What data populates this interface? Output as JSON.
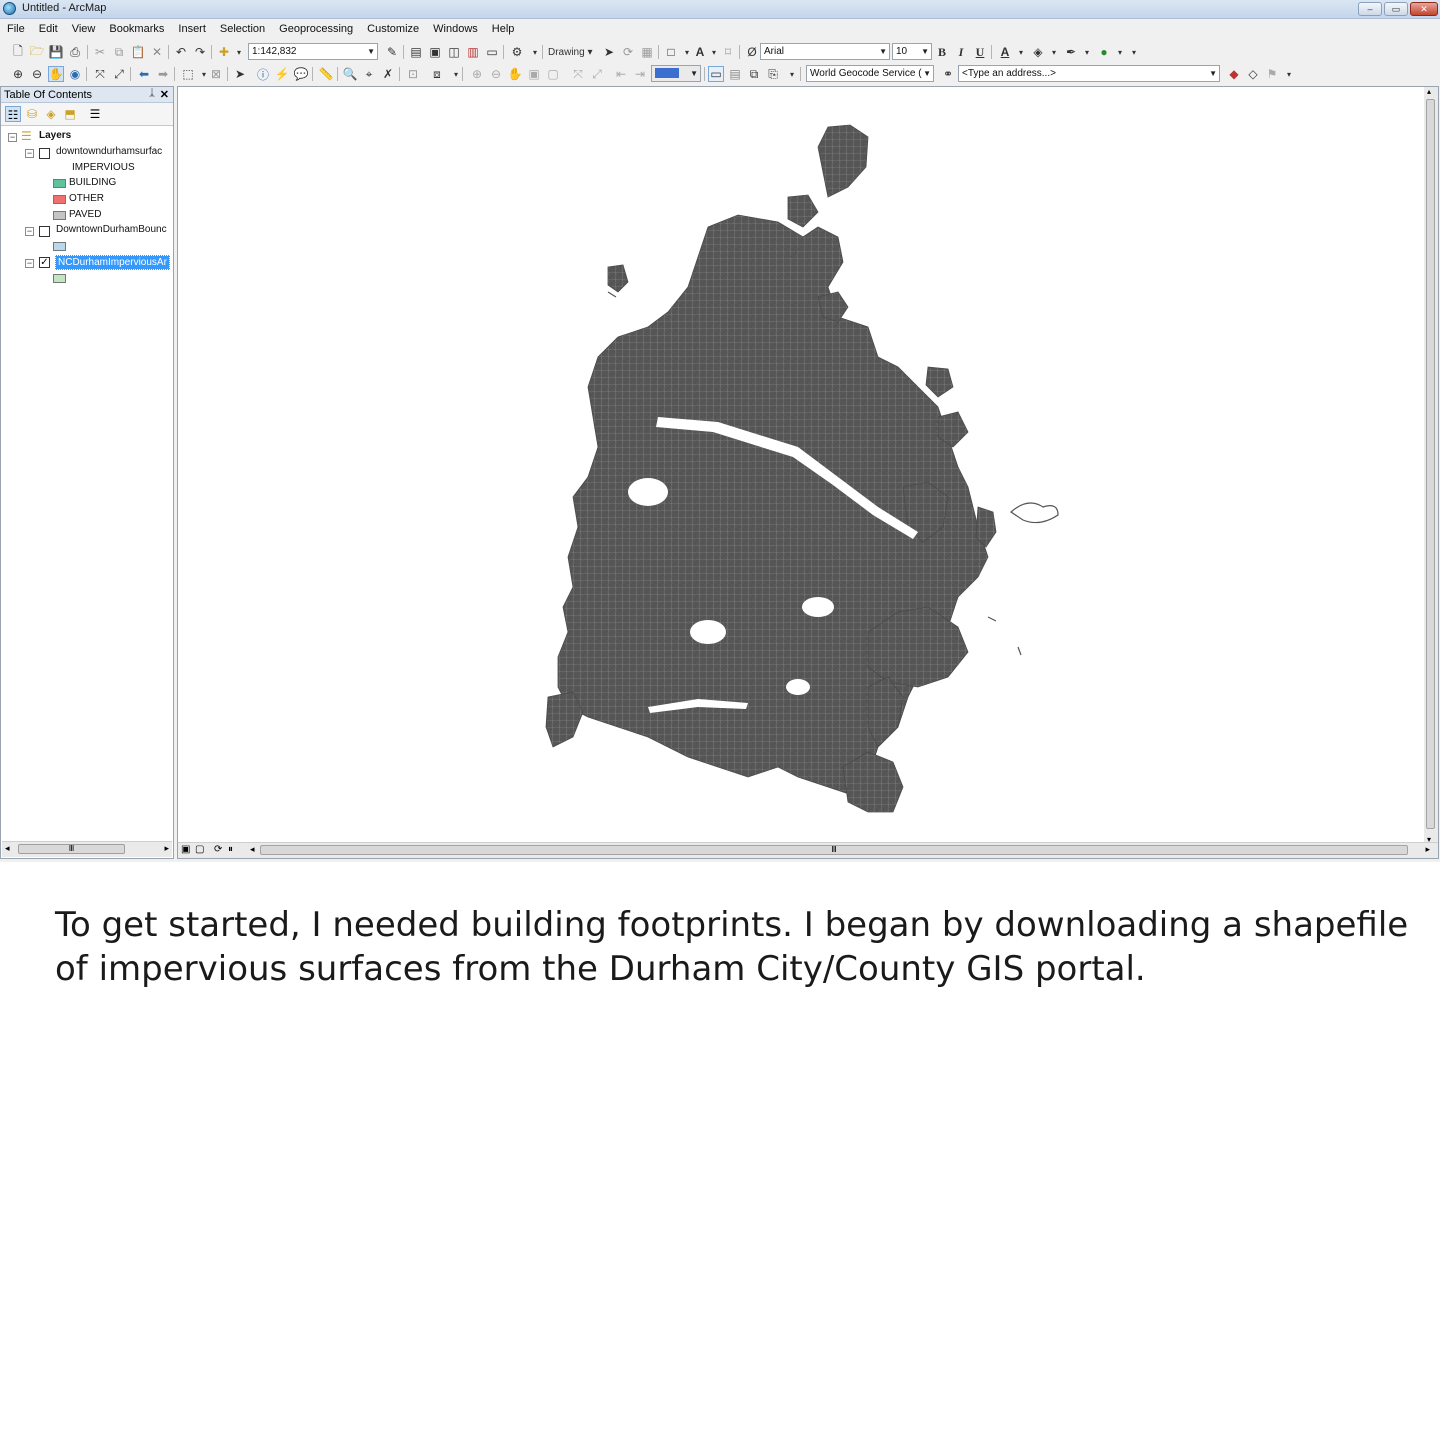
{
  "window": {
    "title": "Untitled - ArcMap",
    "minimize": "–",
    "restore": "▭",
    "close": "✕"
  },
  "menu": [
    "File",
    "Edit",
    "View",
    "Bookmarks",
    "Insert",
    "Selection",
    "Geoprocessing",
    "Customize",
    "Windows",
    "Help"
  ],
  "toolbar": {
    "scale": "1:142,832",
    "drawing_label": "Drawing ▾",
    "font_name": "Arial",
    "font_size": "10",
    "bold": "B",
    "italic": "I",
    "underline": "U",
    "geocode_service": "World Geocode Service (",
    "address_placeholder": "<Type an address...>"
  },
  "toc": {
    "title": "Table Of Contents",
    "pin": "ᛣ",
    "close": "✕",
    "root": "Layers",
    "layers": [
      {
        "name": "downtowndurhamsurfac",
        "checked": false,
        "expanded": true,
        "field": "IMPERVIOUS",
        "classes": [
          {
            "label": "BUILDING",
            "color": "#5fc29a"
          },
          {
            "label": "OTHER",
            "color": "#f07070"
          },
          {
            "label": "PAVED",
            "color": "#c4c4c4"
          }
        ]
      },
      {
        "name": "DowntownDurhamBounc",
        "checked": false,
        "expanded": true,
        "symbol_color": "#b7d8ee"
      },
      {
        "name": "NCDurhamImperviousAr",
        "checked": true,
        "expanded": true,
        "selected": true,
        "symbol_color": "#bfe6bf"
      }
    ]
  },
  "map": {
    "fill_color": "#555555",
    "background": "#ffffff"
  },
  "caption": "To get started, I needed building footprints. I began by downloading a shapefile of impervious surfaces from the Durham City/County GIS portal."
}
